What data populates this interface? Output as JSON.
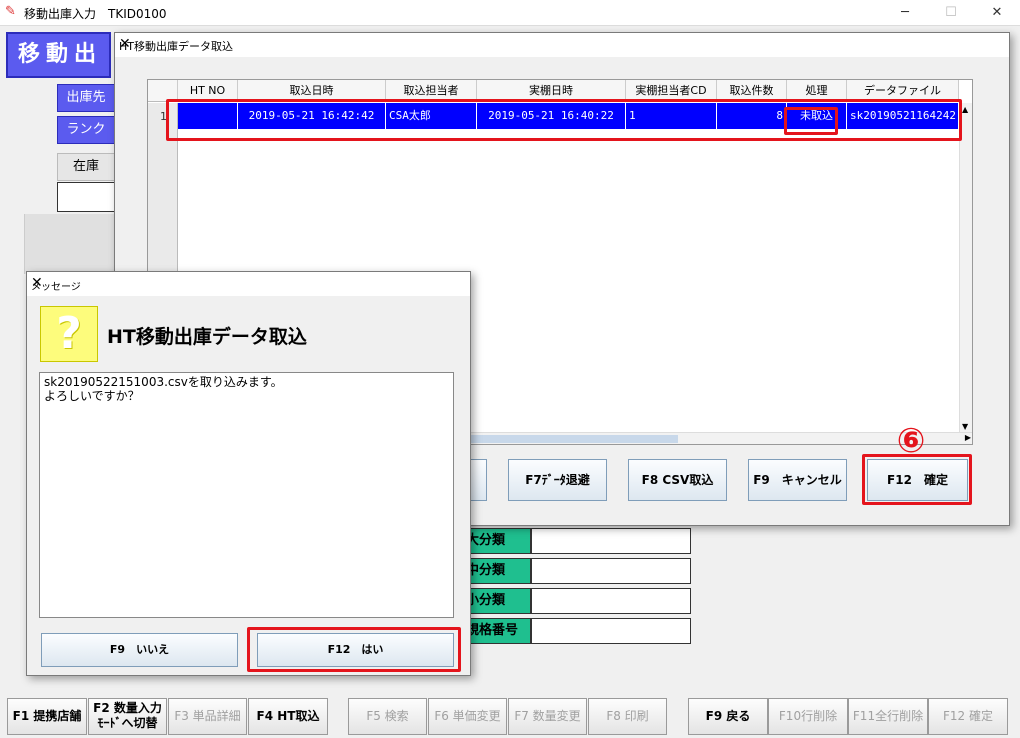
{
  "main": {
    "window_title": "移動出庫入力　TKID0100",
    "header": "移動出",
    "btn1": "出庫先",
    "btn2": "ランク",
    "stock_label": "在庫",
    "labels": [
      "大分類",
      "中分類",
      "小分類",
      "規格番号"
    ]
  },
  "fkeys": {
    "f1": "F1 提携店舗",
    "f2_line1": "F2 数量入力",
    "f2_line2": "ﾓｰﾄﾞへ切替",
    "f3": "F3 単品詳細",
    "f4": "F4 HT取込",
    "f5": "F5 検索",
    "f6": "F6 単価変更",
    "f7": "F7 数量変更",
    "f8": "F8 印刷",
    "f9": "F9 戻る",
    "f10": "F10行削除",
    "f11": "F11全行削除",
    "f12": "F12 確定"
  },
  "ht_dialog": {
    "title": "HT移動出庫データ取込",
    "columns": [
      "HT NO",
      "取込日時",
      "取込担当者",
      "実棚日時",
      "実棚担当者CD",
      "取込件数",
      "処理",
      "データファイル"
    ],
    "row": {
      "ht_no": "",
      "import_datetime": "2019-05-21 16:42:42",
      "importer": "CSA太郎",
      "inventory_datetime": "2019-05-21 16:40:22",
      "inventory_cd": "1",
      "count": "8",
      "status": "未取込",
      "file": "sk20190521164242"
    },
    "row_marker": "1",
    "step_badge": "⑥",
    "buttons": {
      "f7": "F7ﾃﾞｰﾀ退避",
      "f8": "F8 CSV取込",
      "f9": "F9　キャンセル",
      "f12": "F12　確定"
    }
  },
  "msg_dialog": {
    "title": "メッセージ",
    "icon_char": "?",
    "heading": "HT移動出庫データ取込",
    "line1": "sk20190522151003.csvを取り込みます。",
    "line2": "よろしいですか？",
    "no": "F9　いいえ",
    "yes": "F12　はい"
  },
  "colors": {
    "selected_row": "#0000ff",
    "highlight": "#e4141c",
    "header_blue": "#5b5bef",
    "label_green": "#1fbf8f"
  }
}
